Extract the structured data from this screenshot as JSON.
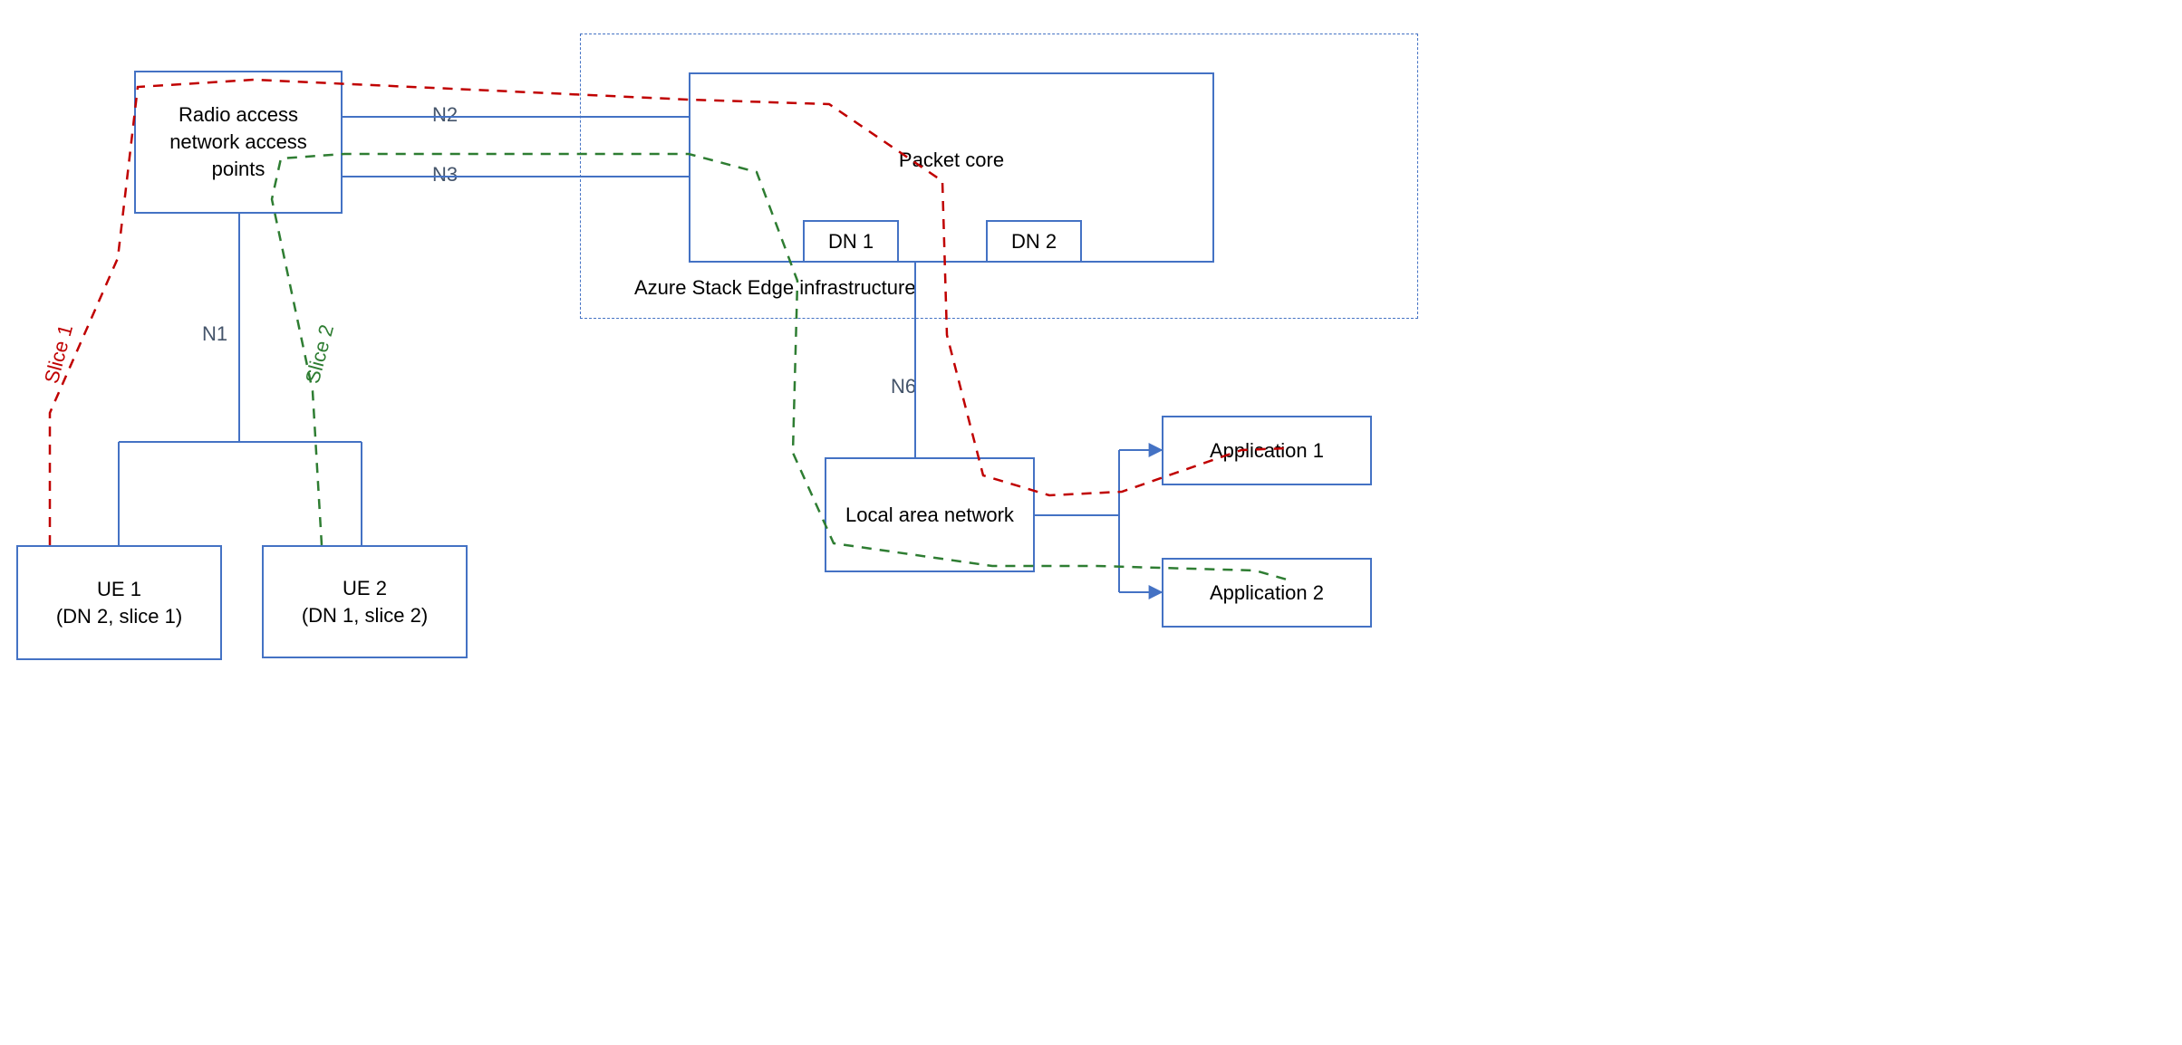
{
  "nodes": {
    "ran": {
      "label": "Radio access\nnetwork access\npoints"
    },
    "packet_core": {
      "label": "Packet core"
    },
    "dn1": {
      "label": "DN 1"
    },
    "dn2": {
      "label": "DN 2"
    },
    "ase": {
      "label": "Azure Stack Edge infrastructure"
    },
    "ue1": {
      "label": "UE 1\n(DN 2, slice 1)"
    },
    "ue2": {
      "label": "UE 2\n(DN 1, slice 2)"
    },
    "lan": {
      "label": "Local area network"
    },
    "app1": {
      "label": "Application 1"
    },
    "app2": {
      "label": "Application 2"
    }
  },
  "links": {
    "n1": {
      "label": "N1"
    },
    "n2": {
      "label": "N2"
    },
    "n3": {
      "label": "N3"
    },
    "n6": {
      "label": "N6"
    }
  },
  "slices": {
    "slice1": {
      "label": "Slice 1",
      "color": "#c00000"
    },
    "slice2": {
      "label": "Slice 2",
      "color": "#2e7d32"
    }
  },
  "colors": {
    "box_border": "#4472c4",
    "link": "#4472c4",
    "link_label": "#44546a",
    "slice1": "#c00000",
    "slice2": "#2e7d32"
  }
}
